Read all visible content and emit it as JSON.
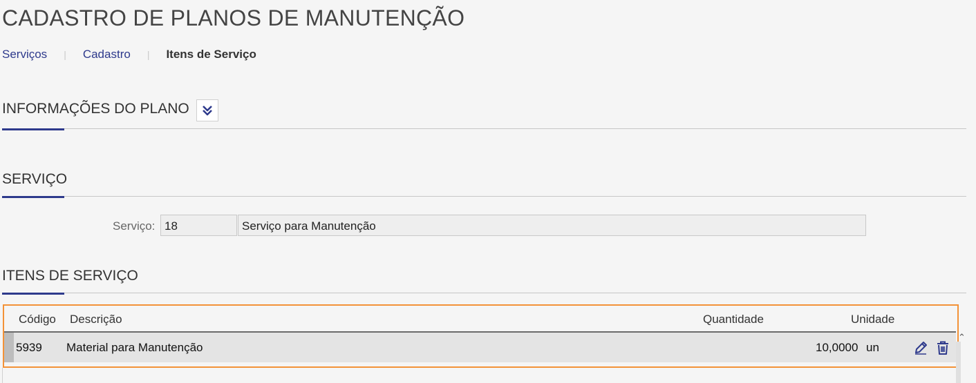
{
  "page": {
    "title": "CADASTRO DE PLANOS DE MANUTENÇÃO"
  },
  "breadcrumb": {
    "items": [
      {
        "label": "Serviços"
      },
      {
        "label": "Cadastro"
      },
      {
        "label": "Itens de Serviço"
      }
    ],
    "separator": "|"
  },
  "sections": {
    "plan_info": {
      "title": "INFORMAÇÕES DO PLANO",
      "toggle_icon": "double-chevron-down-icon"
    },
    "service": {
      "title": "SERVIÇO"
    },
    "service_items": {
      "title": "ITENS DE SERVIÇO"
    }
  },
  "service_field": {
    "label": "Serviço:",
    "code": "18",
    "description": "Serviço para Manutenção"
  },
  "items_grid": {
    "columns": [
      "Código",
      "Descrição",
      "Quantidade",
      "Unidade"
    ],
    "rows": [
      {
        "code": "5939",
        "description": "Material para Manutenção",
        "quantity": "10,0000",
        "unit": "un"
      }
    ],
    "row_actions": [
      "edit-icon",
      "delete-icon"
    ],
    "highlight_color": "#f39237"
  },
  "colors": {
    "accent": "#2e3a8c",
    "background": "#f5f5f5"
  }
}
